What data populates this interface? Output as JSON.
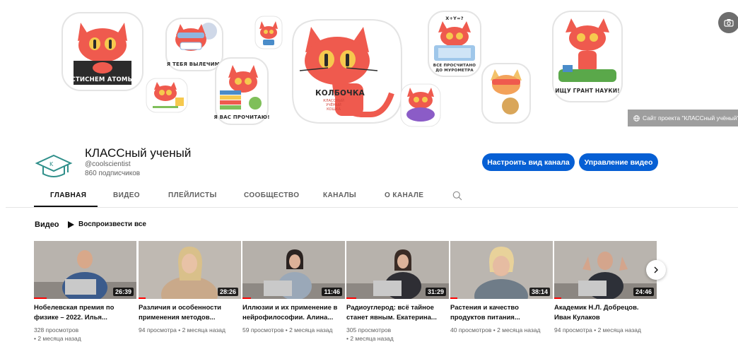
{
  "banner": {
    "stickers": {
      "atoms": "СТИСНЕМ АТОМЫ",
      "heal": "Я ТЕБЯ ВЫЛЕЧИМ!",
      "read": "Я ВАС ПРОЧИТАЮ!",
      "main": "КОЛБОЧКА",
      "main_sub": "КЛАССНЫЙ УЧЁНЫЙ КОШКА",
      "formula": "X+Y=?",
      "murometr": "ВСЕ ПРОСЧИТАНО ДО МУРОМЕТРА",
      "grant": "ИЩУ ГРАНТ НАУКИ!"
    },
    "site_link": "Сайт проекта \"КЛАССный учёный\"",
    "camera_icon": "camera-icon"
  },
  "channel": {
    "title": "КЛАССный ученый",
    "handle": "@coolscientist",
    "subscribers": "860 подписчиков",
    "customize_button": "Настроить вид канала",
    "manage_button": "Управление видео",
    "accent_color": "#065fd4"
  },
  "tabs": [
    "ГЛАВНАЯ",
    "ВИДЕО",
    "ПЛЕЙЛИСТЫ",
    "СООБЩЕСТВО",
    "КАНАЛЫ",
    "О КАНАЛЕ"
  ],
  "section": {
    "title": "Видео",
    "play_all": "Воспроизвести все"
  },
  "videos": [
    {
      "title": "Нобелевская премия по физике – 2022. Илья...",
      "duration": "26:39",
      "views": "328 просмотров",
      "age": "• 2 месяца назад"
    },
    {
      "title": "Различия и особенности применения методов...",
      "duration": "28:26",
      "views": "94 просмотра",
      "age": "• 2 месяца назад"
    },
    {
      "title": "Иллюзии и их применение в нейрофилософии. Алина...",
      "duration": "11:46",
      "views": "59 просмотров",
      "age": "• 2 месяца назад"
    },
    {
      "title": "Радиоуглерод: всё тайное станет явным. Екатерина...",
      "duration": "31:29",
      "views": "305 просмотров",
      "age": "• 2 месяца назад"
    },
    {
      "title": "Растения и качество продуктов питания...",
      "duration": "38:14",
      "views": "40 просмотров",
      "age": "• 2 месяца назад"
    },
    {
      "title": "Академик Н.Л. Добрецов. Иван Кулаков",
      "duration": "24:46",
      "views": "94 просмотра",
      "age": "• 2 месяца назад"
    }
  ]
}
